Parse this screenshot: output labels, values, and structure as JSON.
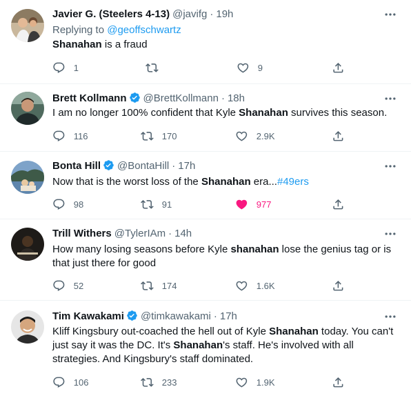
{
  "tweets": [
    {
      "name": "Javier G. (Steelers 4-13)",
      "handle": "@javifg",
      "time": "19h",
      "verified": false,
      "replying_prefix": "Replying to ",
      "replying_to": "@geoffschwartz",
      "text": [
        {
          "b": "Shanahan"
        },
        {
          "t": " is a fraud"
        }
      ],
      "replies": "1",
      "retweets": "",
      "likes": "9",
      "liked": false
    },
    {
      "name": "Brett Kollmann",
      "handle": "@BrettKollmann",
      "time": "18h",
      "verified": true,
      "text": [
        {
          "t": "I am no longer 100% confident that Kyle "
        },
        {
          "b": "Shanahan"
        },
        {
          "t": " survives this season."
        }
      ],
      "replies": "116",
      "retweets": "170",
      "likes": "2.9K",
      "liked": false
    },
    {
      "name": "Bonta Hill",
      "handle": "@BontaHill",
      "time": "17h",
      "verified": true,
      "text": [
        {
          "t": "Now that is the worst loss of the "
        },
        {
          "b": "Shanahan"
        },
        {
          "t": " era..."
        },
        {
          "tag": "#49ers"
        }
      ],
      "replies": "98",
      "retweets": "91",
      "likes": "977",
      "liked": true
    },
    {
      "name": "Trill Withers",
      "handle": "@TylerIAm",
      "time": "14h",
      "verified": false,
      "text": [
        {
          "t": "How many losing seasons before Kyle "
        },
        {
          "b": "shanahan"
        },
        {
          "t": " lose the genius tag or is"
        },
        {
          "br": true
        },
        {
          "t": "that just there for good"
        }
      ],
      "replies": "52",
      "retweets": "174",
      "likes": "1.6K",
      "liked": false
    },
    {
      "name": "Tim Kawakami",
      "handle": "@timkawakami",
      "time": "17h",
      "verified": true,
      "text": [
        {
          "t": "Kliff Kingsbury out-coached the hell out of Kyle "
        },
        {
          "b": "Shanahan"
        },
        {
          "t": " today. You can't"
        },
        {
          "br": true
        },
        {
          "t": "just say it was the DC. It's "
        },
        {
          "b": "Shanahan"
        },
        {
          "t": "'s staff. He's involved with all"
        },
        {
          "br": true
        },
        {
          "t": "strategies. And Kingsbury's staff dominated."
        }
      ],
      "replies": "106",
      "retweets": "233",
      "likes": "1.9K",
      "liked": false
    }
  ],
  "icons": {
    "reply": "reply-icon",
    "retweet": "retweet-icon",
    "like": "heart-icon",
    "share": "share-icon",
    "more": "more-icon",
    "verified": "verified-badge-icon"
  },
  "colors": {
    "accent": "#1d9bf0",
    "like": "#f91880",
    "muted": "#536471"
  }
}
